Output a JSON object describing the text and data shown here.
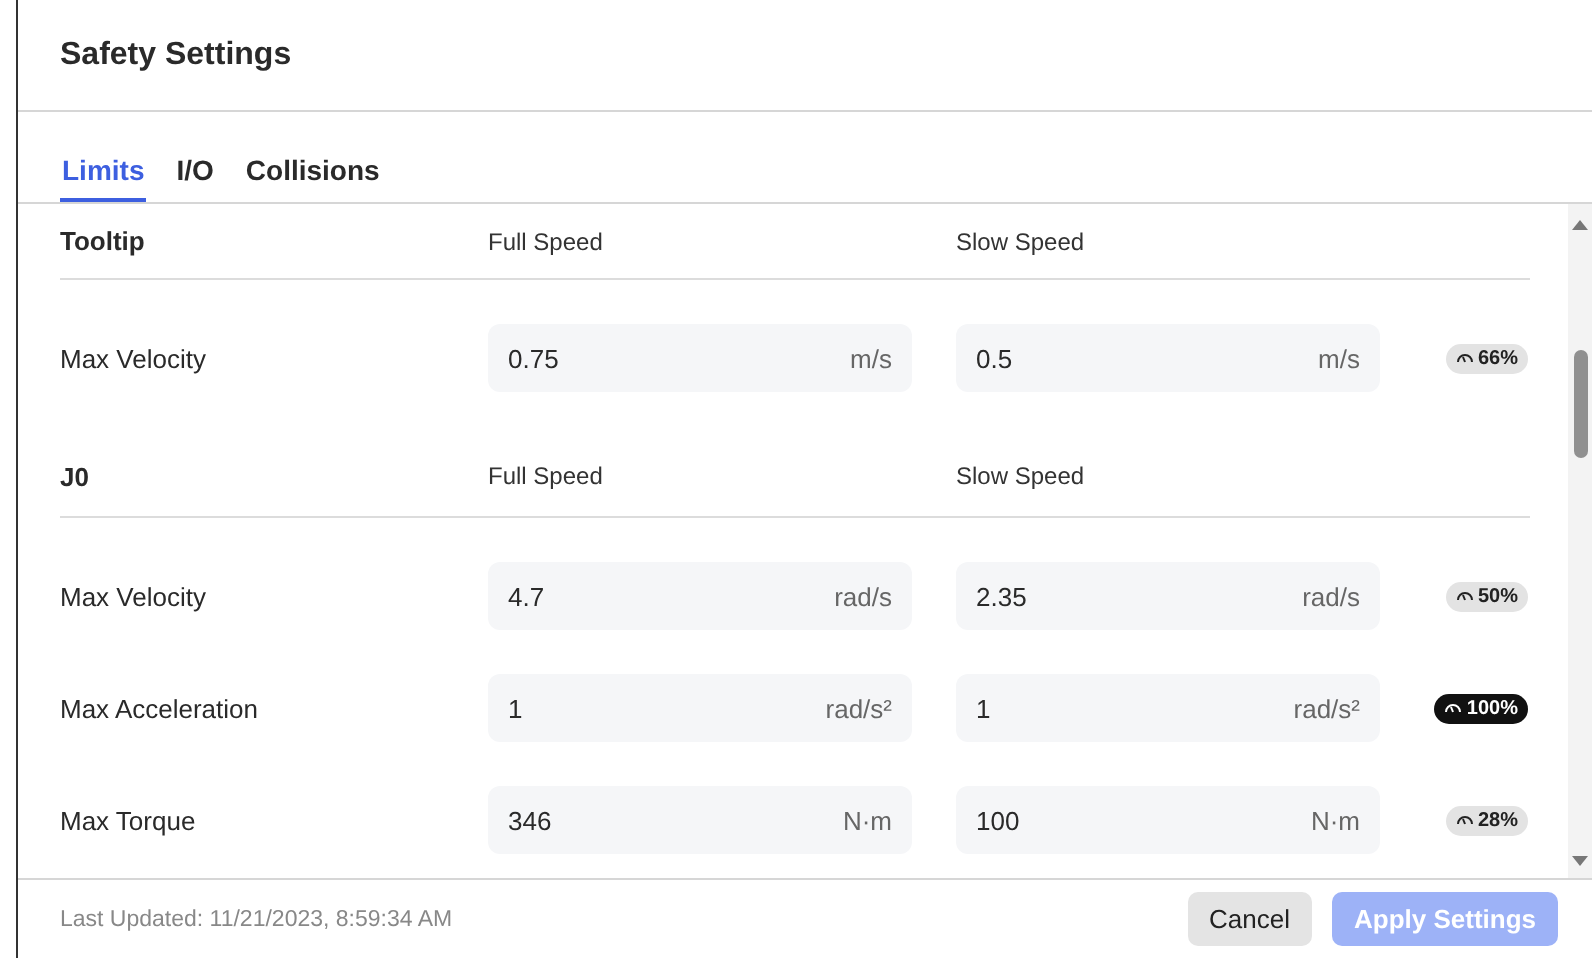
{
  "dialog": {
    "title": "Safety Settings"
  },
  "tabs": [
    {
      "label": "Limits",
      "selected": true
    },
    {
      "label": "I/O",
      "selected": false
    },
    {
      "label": "Collisions",
      "selected": false
    }
  ],
  "groups": [
    {
      "name": "Tooltip",
      "full_heading": "Full Speed",
      "slow_heading": "Slow Speed",
      "rows": [
        {
          "label": "Max Velocity",
          "full": "0.75",
          "full_unit": "m/s",
          "slow": "0.5",
          "slow_unit": "m/s",
          "ratio": "66%",
          "highlighted": false
        }
      ]
    },
    {
      "name": "J0",
      "full_heading": "Full Speed",
      "slow_heading": "Slow Speed",
      "rows": [
        {
          "label": "Max Velocity",
          "full": "4.7",
          "full_unit": "rad/s",
          "slow": "2.35",
          "slow_unit": "rad/s",
          "ratio": "50%",
          "highlighted": false
        },
        {
          "label": "Max Acceleration",
          "full": "1",
          "full_unit": "rad/s²",
          "slow": "1",
          "slow_unit": "rad/s²",
          "ratio": "100%",
          "highlighted": true
        },
        {
          "label": "Max Torque",
          "full": "346",
          "full_unit": "N·m",
          "slow": "100",
          "slow_unit": "N·m",
          "ratio": "28%",
          "highlighted": false
        }
      ]
    }
  ],
  "footer": {
    "last_updated": "Last Updated: 11/21/2023, 8:59:34 AM",
    "buttons": [
      {
        "label": "Cancel",
        "kind": "secondary",
        "disabled": false
      },
      {
        "label": "Apply Settings",
        "kind": "primary",
        "disabled": true
      }
    ]
  }
}
